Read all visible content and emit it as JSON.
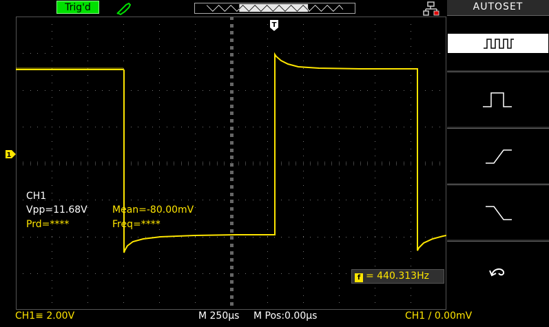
{
  "top_bar": {
    "trigger_status": "Trig'd"
  },
  "measurements": {
    "channel": "CH1",
    "vpp": "Vpp=11.68V",
    "mean": "Mean=-80.00mV",
    "prd": "Prd=****",
    "freq": "Freq=****"
  },
  "markers": {
    "trigger_pos": "T",
    "ch1": "1"
  },
  "frequency_counter": {
    "icon": "f",
    "value": "= 440.313Hz"
  },
  "side_menu": {
    "title": "AUTOSET",
    "items": [
      {
        "name": "multi-period-icon"
      },
      {
        "name": "single-period-icon"
      },
      {
        "name": "rising-edge-icon"
      },
      {
        "name": "falling-edge-icon"
      },
      {
        "name": "undo-icon"
      }
    ]
  },
  "bottom_bar": {
    "ch1_scale": "CH1≡ 2.00V",
    "timebase": "M 250µs",
    "mpos": "M Pos:0.00µs",
    "trigger": "CH1 ∕ 0.00mV"
  },
  "colors": {
    "ch1": "#ffe600",
    "trig_status_bg": "#00e000",
    "menu_bg": "#2a2a2a"
  }
}
